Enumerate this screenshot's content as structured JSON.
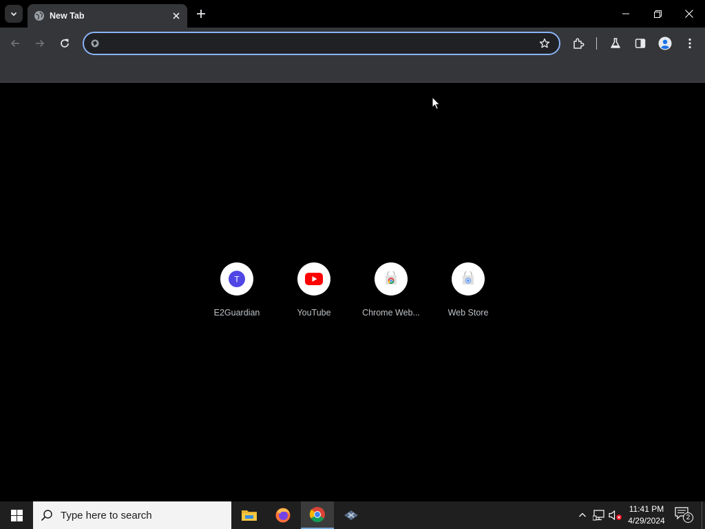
{
  "browser": {
    "tab": {
      "title": "New Tab",
      "favicon": "globe-icon"
    },
    "omnibox": {
      "value": "",
      "placeholder": ""
    },
    "accent": "#8ab4f8",
    "icons": [
      "tab-search-icon",
      "close-icon",
      "plus-icon",
      "minimize-icon",
      "restore-icon",
      "back-icon",
      "forward-icon",
      "reload-icon",
      "star-icon",
      "extensions-icon",
      "labs-icon",
      "side-panel-icon",
      "profile-icon",
      "menu-icon"
    ]
  },
  "shortcuts": [
    {
      "label": "E2Guardian",
      "icon": "letter-t-icon",
      "letter": "T",
      "color": "#4f46e5"
    },
    {
      "label": "YouTube",
      "icon": "youtube-icon",
      "color": "#ff0000"
    },
    {
      "label": "Chrome Web...",
      "icon": "chrome-web-store-icon"
    },
    {
      "label": "Web Store",
      "icon": "web-store-icon"
    }
  ],
  "taskbar": {
    "search_placeholder": "Type here to search",
    "apps": [
      "file-explorer-icon",
      "firefox-icon",
      "chrome-icon",
      "app-icon"
    ],
    "active_app": "chrome-icon",
    "clock_time": "11:41 PM",
    "clock_date": "4/29/2024",
    "notification_count": "2"
  }
}
